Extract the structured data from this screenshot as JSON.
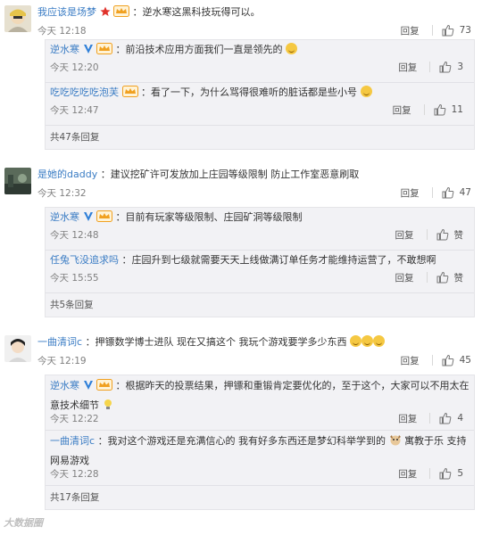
{
  "icons": {
    "like": "thumbs-up-icon",
    "vip": "vip-crown-icon",
    "verified": "verified-v-icon",
    "laugh": "laughing-emoji-icon",
    "watermark": "dgtle-logo"
  },
  "reply_label": "回复",
  "threads": [
    {
      "comment": {
        "user": "我应该是场梦",
        "text": "：逆水寒这黑科技玩得可以。",
        "time": "今天 12:18",
        "likes": "73"
      },
      "replies": [
        {
          "user": "逆水寒",
          "text": "：前沿技术应用方面我们一直是领先的",
          "time": "今天 12:20",
          "likes": "3"
        },
        {
          "user": "吃吃吃吃吃泡芙",
          "text": "：看了一下，为什么骂得很难听的脏话都是些小号",
          "time": "今天 12:47",
          "likes": "11"
        }
      ],
      "more": "共47条回复"
    },
    {
      "comment": {
        "user": "是她的daddy",
        "text": "：建议挖矿许可发放加上庄园等级限制 防止工作室恶意刷取",
        "time": "今天 12:32",
        "likes": "47"
      },
      "replies": [
        {
          "user": "逆水寒",
          "text": "：目前有玩家等级限制、庄园矿洞等级限制",
          "time": "今天 12:48",
          "likes": "赞"
        },
        {
          "user": "任兔飞没追求吗",
          "text": "：庄园升到七级就需要天天上线做满订单任务才能维持运营了，不敢想啊",
          "time": "今天 15:55",
          "likes": "赞"
        }
      ],
      "more": "共5条回复"
    },
    {
      "comment": {
        "user": "一曲清词c",
        "text": "：押镖数学博士进队 现在又搞这个 我玩个游戏要学多少东西",
        "time": "今天 12:19",
        "likes": "45"
      },
      "replies": [
        {
          "user": "逆水寒",
          "text": "：根据昨天的投票结果，押镖和重锻肯定要优化的，至于这个，大家可以不用太在意技术细节",
          "time": "今天 12:22",
          "likes": "4"
        },
        {
          "user": "一曲清词c",
          "text": "：我对这个游戏还是充满信心的 我有好多东西还是梦幻科举学到的",
          "extra": "寓教于乐 支持网易游戏",
          "time": "今天 12:28",
          "likes": "5"
        }
      ],
      "more": "共17条回复"
    }
  ],
  "watermark": "大数据圈"
}
